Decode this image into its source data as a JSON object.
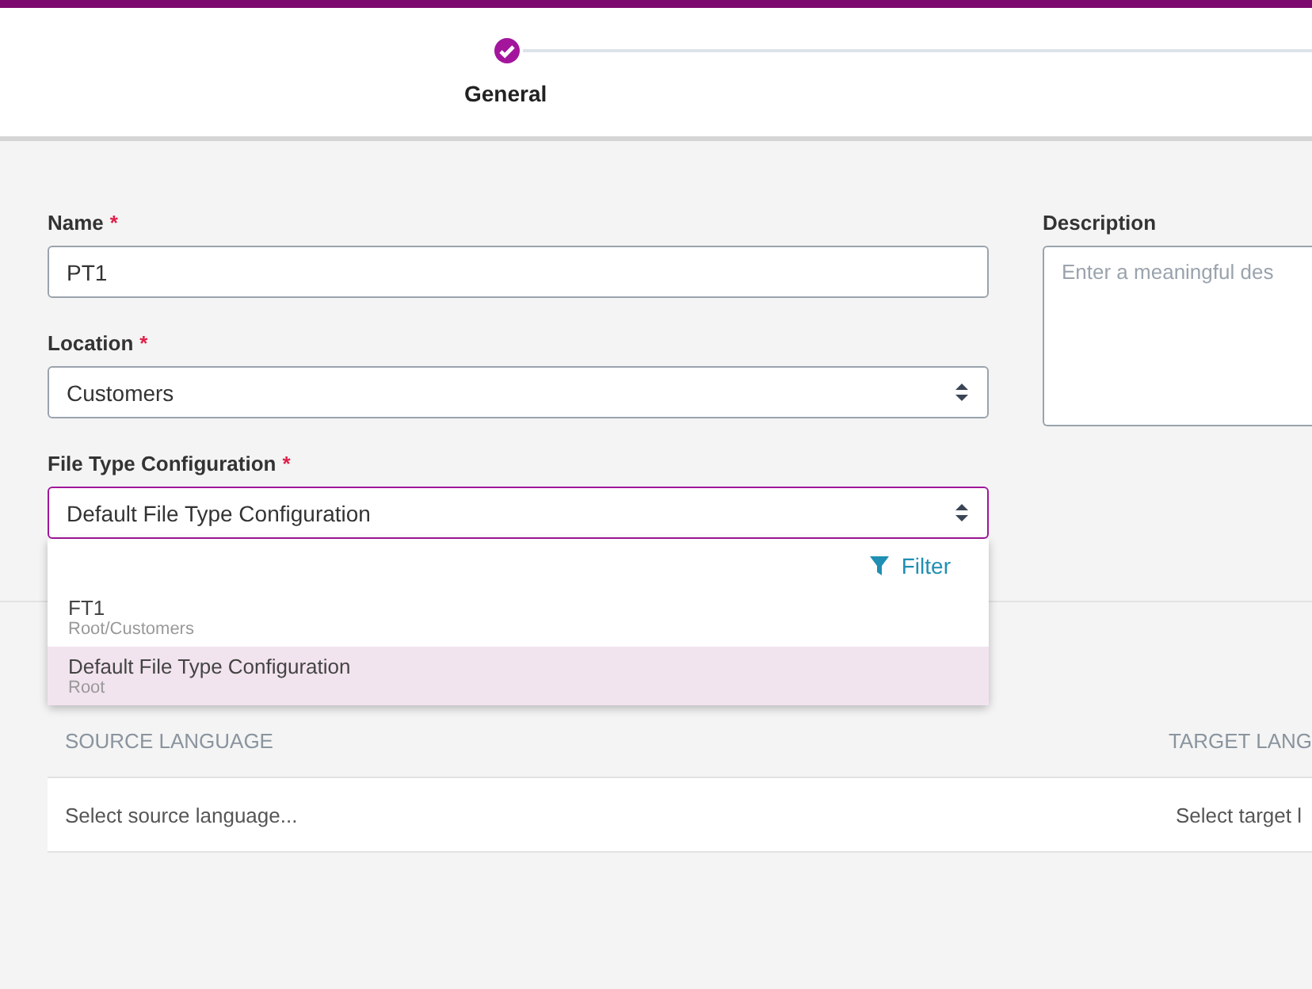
{
  "stepper": {
    "steps": [
      {
        "label": "General",
        "completed": true
      }
    ]
  },
  "form": {
    "name": {
      "label": "Name",
      "required_mark": "*",
      "value": "PT1"
    },
    "location": {
      "label": "Location",
      "required_mark": "*",
      "value": "Customers"
    },
    "file_type_configuration": {
      "label": "File Type Configuration",
      "required_mark": "*",
      "value": "Default File Type Configuration",
      "focused": true
    },
    "description": {
      "label": "Description",
      "placeholder": "Enter a meaningful des"
    }
  },
  "dropdown": {
    "filter": "Filter",
    "options": [
      {
        "title": "FT1",
        "path": "Root/Customers",
        "selected": false
      },
      {
        "title": "Default File Type Configuration",
        "path": "Root",
        "selected": true
      }
    ]
  },
  "table": {
    "columns": [
      "SOURCE LANGUAGE",
      "TARGET LANG"
    ],
    "rows": [
      [
        "Select source language...",
        "Select target l"
      ]
    ]
  }
}
